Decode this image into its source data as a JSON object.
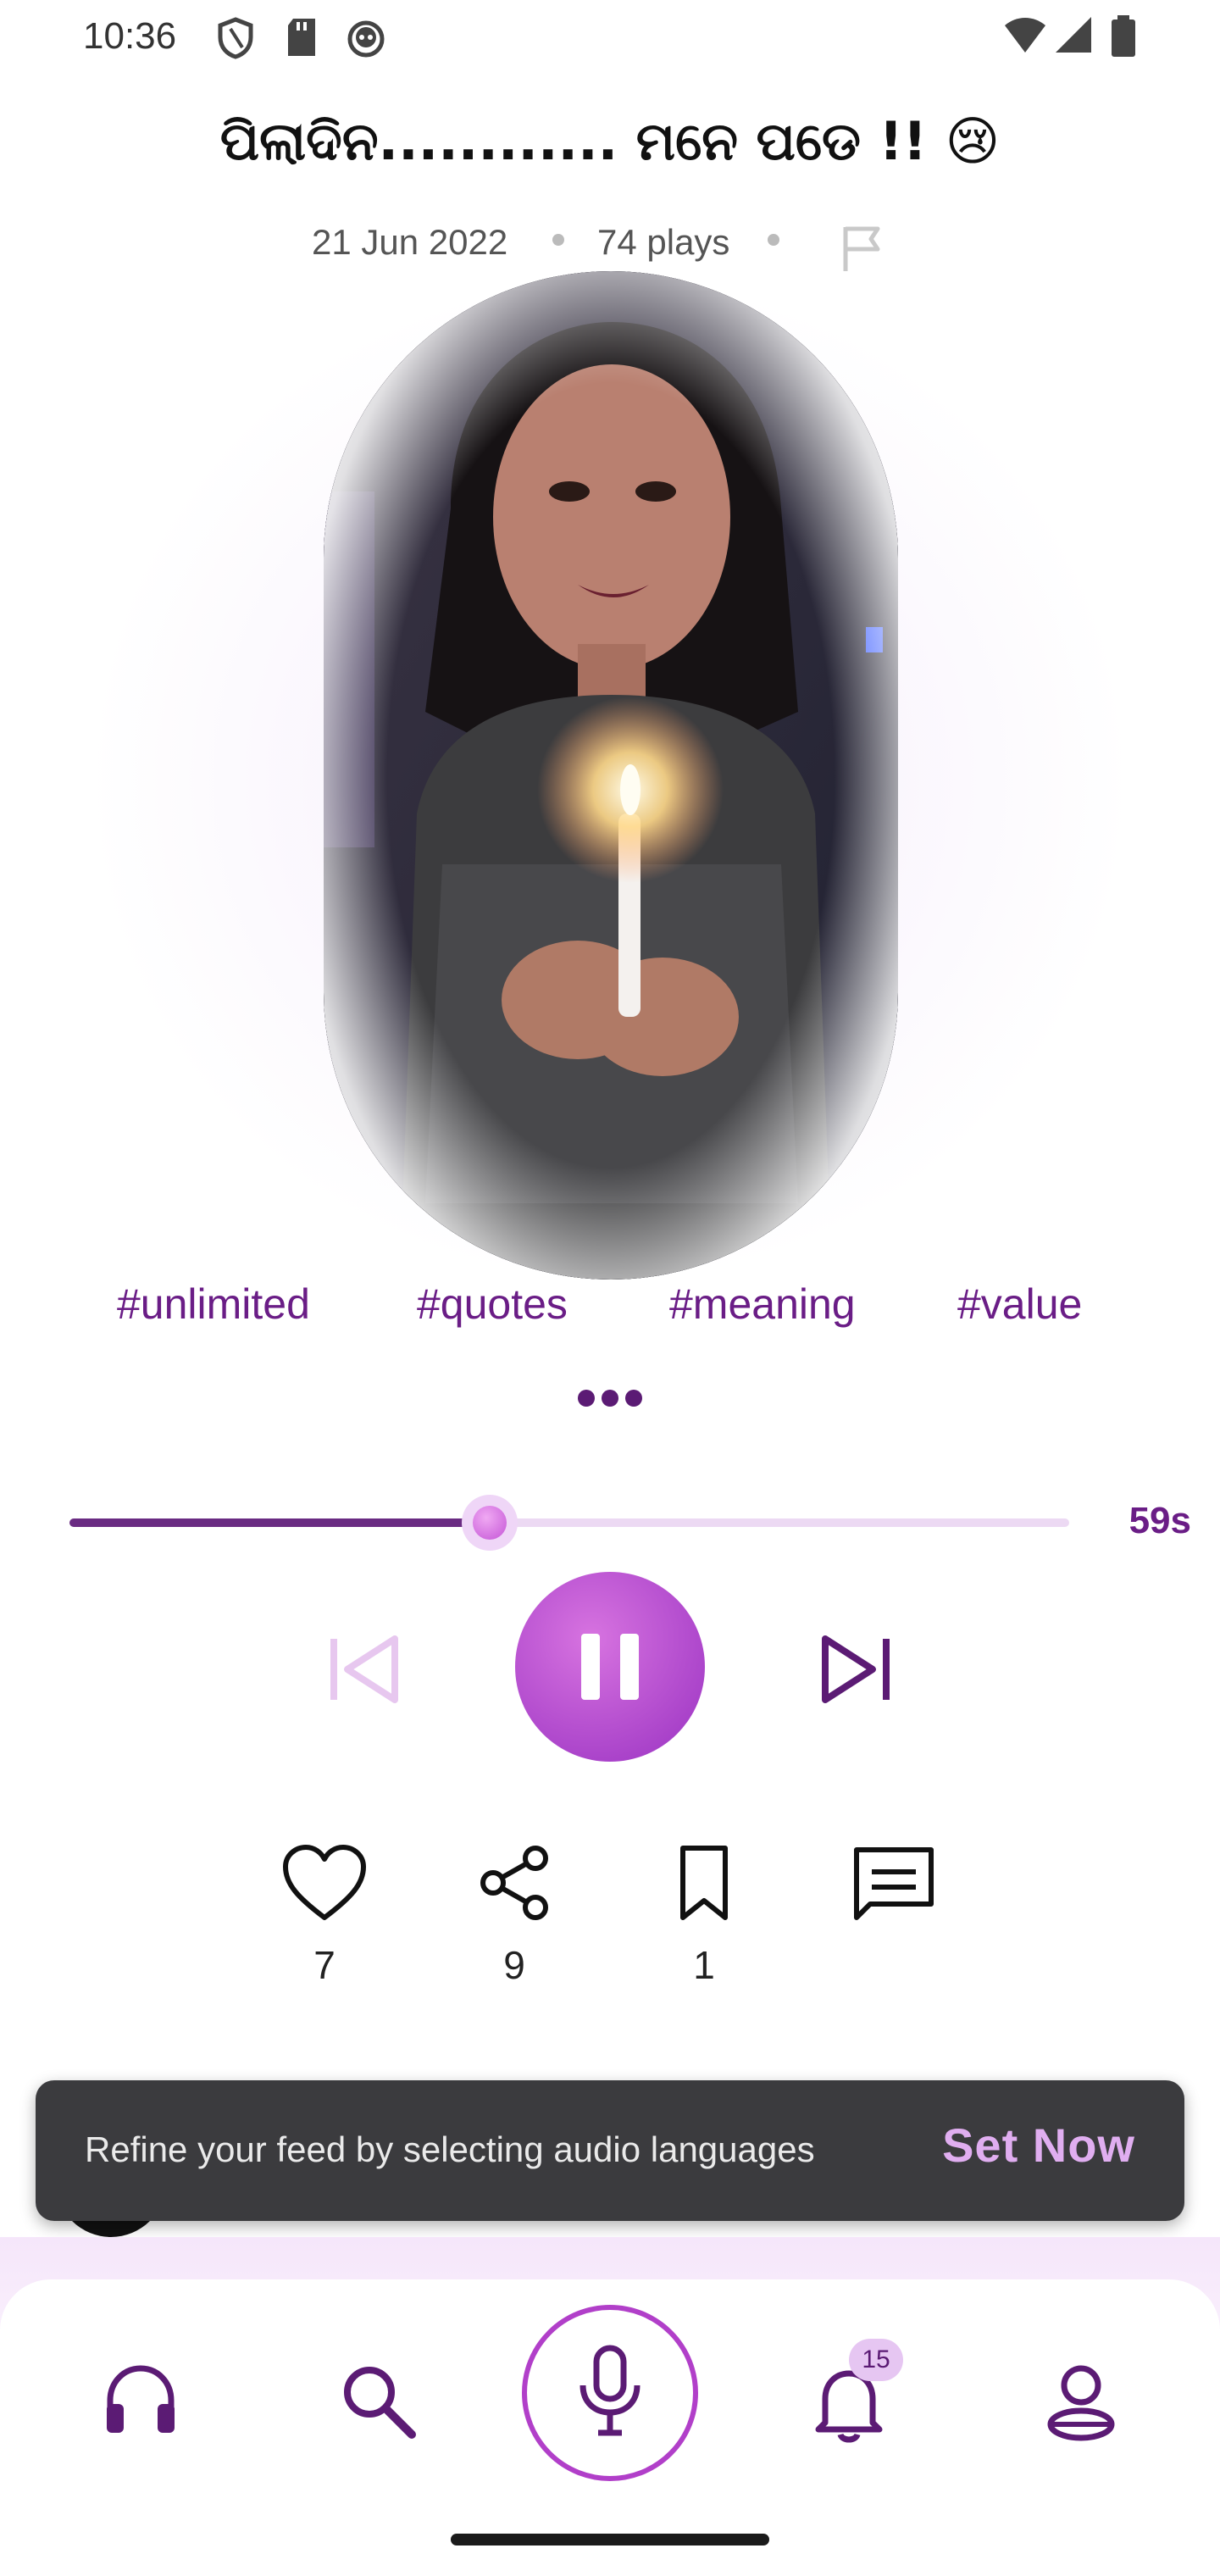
{
  "status_bar": {
    "time": "10:36"
  },
  "post": {
    "title": "ପିଲାଦିନ............ ମନେ ପଡେ !! 😢",
    "date": "21 Jun 2022",
    "plays": "74 plays"
  },
  "tags": [
    "#unlimited",
    "#quotes",
    "#meaning",
    "#value"
  ],
  "player": {
    "progress": 0.42,
    "remaining": "59s"
  },
  "actions": {
    "likes": "7",
    "shares": "9",
    "saves": "1"
  },
  "toast": {
    "message": "Refine your feed by selecting audio languages",
    "action": "Set Now"
  },
  "nav": {
    "notifications_badge": "15"
  },
  "colors": {
    "accent": "#6a1d86",
    "play_button": "#b44fd1",
    "toast_bg": "#3b3b3e",
    "toast_action": "#e0aef0"
  }
}
